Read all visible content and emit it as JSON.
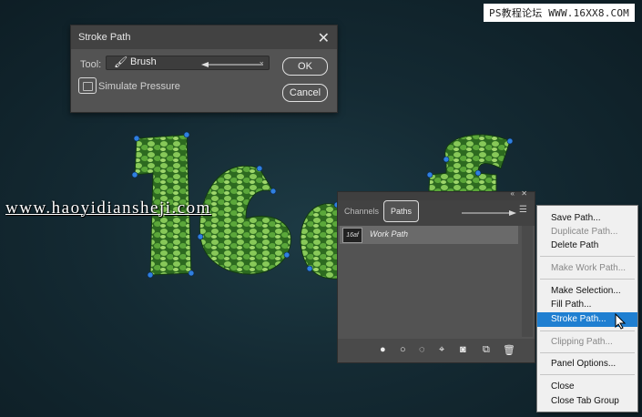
{
  "watermarks": {
    "top": "PS教程论坛 WWW.16XX8.COM",
    "middle": "www.haoyidiansheji.com"
  },
  "stroke_dialog": {
    "title": "Stroke Path",
    "tool_label": "Tool:",
    "tool_value": "Brush",
    "simulate_pressure_label": "Simulate Pressure",
    "simulate_pressure_checked": false,
    "ok_label": "OK",
    "cancel_label": "Cancel"
  },
  "paths_panel": {
    "tabs": [
      {
        "label": "Channels",
        "active": false
      },
      {
        "label": "Paths",
        "active": true
      }
    ],
    "path_item": {
      "name": "Work Path",
      "thumb_text": "16af"
    },
    "footer_icons": [
      "fill-path-icon",
      "stroke-path-icon",
      "load-selection-icon",
      "make-work-path-icon",
      "add-mask-icon",
      "new-path-icon",
      "delete-icon"
    ]
  },
  "context_menu": {
    "items": [
      {
        "label": "Save Path...",
        "disabled": false,
        "highlight": false
      },
      {
        "label": "Duplicate Path...",
        "disabled": true,
        "highlight": false
      },
      {
        "label": "Delete Path",
        "disabled": false,
        "highlight": false
      },
      {
        "label": "Make Work Path...",
        "disabled": true,
        "highlight": false
      },
      {
        "label": "Make Selection...",
        "disabled": false,
        "highlight": false
      },
      {
        "label": "Fill Path...",
        "disabled": false,
        "highlight": false
      },
      {
        "label": "Stroke Path...",
        "disabled": false,
        "highlight": true
      },
      {
        "label": "Clipping Path...",
        "disabled": true,
        "highlight": false
      },
      {
        "label": "Panel Options...",
        "disabled": false,
        "highlight": false
      },
      {
        "label": "Close",
        "disabled": false,
        "highlight": false
      },
      {
        "label": "Close Tab Group",
        "disabled": false,
        "highlight": false
      }
    ]
  },
  "colors": {
    "leaf_green": "#3f8f2a",
    "anchor_blue": "#2f7fe0",
    "menu_highlight": "#1f7fd1"
  }
}
